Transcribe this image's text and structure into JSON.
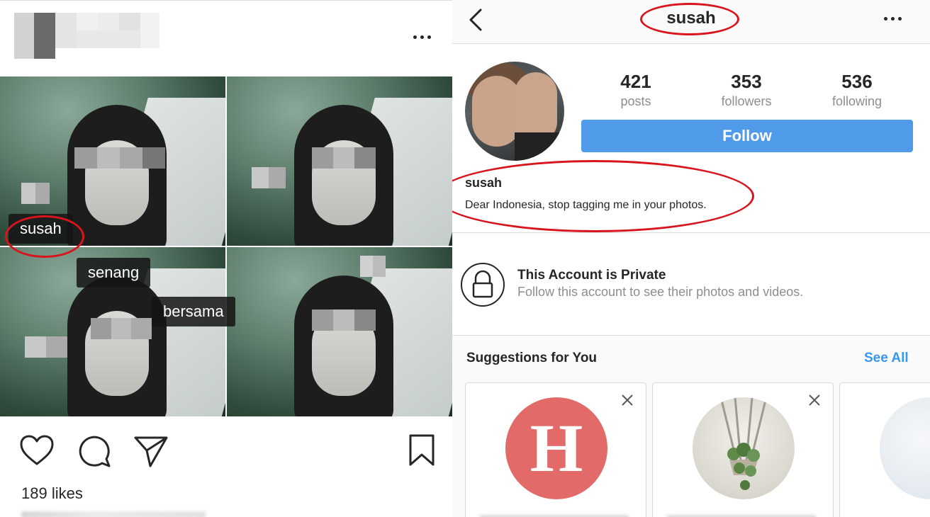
{
  "post": {
    "tags": [
      "susah",
      "senang",
      "bersama"
    ],
    "likes": "189 likes",
    "icons": {
      "more": "more-horizontal-icon",
      "like": "heart-icon",
      "comment": "comment-icon",
      "share": "paper-plane-icon",
      "save": "bookmark-icon"
    }
  },
  "profile": {
    "username": "susah",
    "stats": [
      {
        "count": "421",
        "label": "posts"
      },
      {
        "count": "353",
        "label": "followers"
      },
      {
        "count": "536",
        "label": "following"
      }
    ],
    "follow_label": "Follow",
    "bio_name": "susah",
    "bio_text": "Dear Indonesia, stop tagging me in your photos.",
    "private_title": "This Account is Private",
    "private_subtitle": "Follow this account to see their photos and videos.",
    "suggestions_title": "Suggestions for You",
    "see_all_label": "See All",
    "suggestion_cards": [
      {
        "avatar_letter": "H",
        "avatar_color": "#e26a69"
      },
      {
        "avatar_icon": "hanging-plant-icon"
      }
    ]
  },
  "colors": {
    "follow_button": "#4f9be9",
    "link_blue": "#3897f0",
    "highlight_red": "#d8141c",
    "muted_text": "#8e8e8e"
  }
}
